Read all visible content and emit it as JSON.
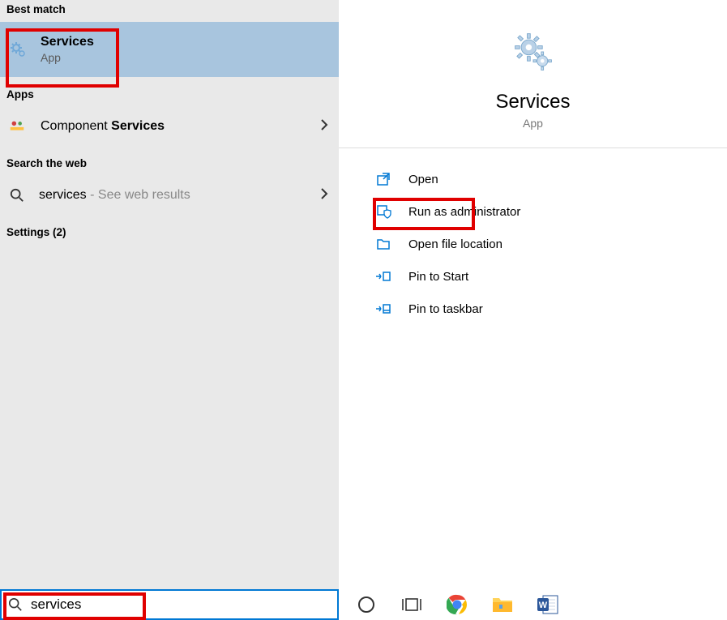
{
  "left": {
    "best_match_header": "Best match",
    "best_match": {
      "title": "Services",
      "sub": "App"
    },
    "apps_header": "Apps",
    "apps_item_prefix": "Component ",
    "apps_item_bold": "Services",
    "web_header": "Search the web",
    "web_item": "services",
    "web_suffix": " - See web results",
    "settings_header": "Settings (2)"
  },
  "right": {
    "title": "Services",
    "sub": "App",
    "actions": {
      "open": "Open",
      "admin": "Run as administrator",
      "location": "Open file location",
      "pin_start": "Pin to Start",
      "pin_taskbar": "Pin to taskbar"
    }
  },
  "search_value": "services"
}
